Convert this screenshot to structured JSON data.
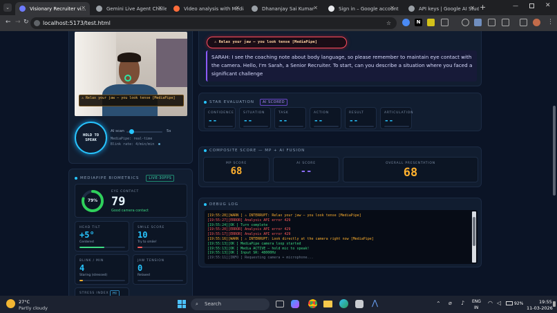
{
  "browser": {
    "tabs": [
      {
        "title": "Visionary Recruiter vi...",
        "active": true,
        "color": "#6e7bff"
      },
      {
        "title": "Gemini Live Agent Challen",
        "active": false,
        "color": "#9aa0a6"
      },
      {
        "title": "Video analysis with Medial",
        "active": false,
        "color": "#ff6d3b"
      },
      {
        "title": "Dhananjay Sai Kumar",
        "active": false,
        "color": "#9aa0a6"
      },
      {
        "title": "Sign in – Google accounts",
        "active": false,
        "color": "#e8eaed"
      },
      {
        "title": "API keys | Google AI Studi",
        "active": false,
        "color": "#9aa0a6"
      }
    ],
    "url": "localhost:5173/test.html"
  },
  "video": {
    "warning": "⚠ Relax your jaw — you look tense [MediaPipe]"
  },
  "controls": {
    "hold_button": "HOLD TO SPEAK",
    "ai_scan_label": "AI scan",
    "ai_scan_value": "5s",
    "mediapipe_status": "MediaPipe: real-time",
    "blink_rate": "Blink rate: 4/min/min"
  },
  "biometrics": {
    "title": "MEDIAPIPE BIOMETRICS",
    "badge": "LIVE·30FPS",
    "eye_contact": {
      "label": "EYE CONTACT",
      "value": "79",
      "ring": "79%",
      "percent": 79,
      "note": "Good camera contact"
    },
    "head_tilt": {
      "label": "HEAD TILT",
      "value": "+5°",
      "note": "Centered",
      "percent": 55
    },
    "smile": {
      "label": "SMILE SCORE",
      "value": "10",
      "note": "Try to smile!",
      "percent": 10
    },
    "blink": {
      "label": "BLINK / MIN",
      "value": "4",
      "note": "Staring (stressed)",
      "percent": 8
    },
    "jaw": {
      "label": "JAW TENSION",
      "value": "0",
      "note": "Relaxed",
      "percent": 0
    },
    "stress": {
      "label": "STRESS INDEX",
      "badge": "HI"
    }
  },
  "chat": {
    "alert": "⚠ Relax your jaw — you look tense [MediaPipe]",
    "message": "SARAH: I see the coaching note about body language, so please remember to maintain eye contact with the camera. Hello, I'm Sarah, a Senior Recruiter. To start, can you describe a situation where you faced a significant challenge"
  },
  "star": {
    "title": "STAR EVALUATION",
    "badge": "AI SCORED",
    "cards": [
      {
        "label": "CONFIDENCE",
        "value": "--"
      },
      {
        "label": "SITUATION",
        "value": "--"
      },
      {
        "label": "TASK",
        "value": "--"
      },
      {
        "label": "ACTION",
        "value": "--"
      },
      {
        "label": "RESULT",
        "value": "--"
      },
      {
        "label": "ARTICULATION",
        "value": "--"
      }
    ]
  },
  "composite": {
    "title": "COMPOSITE SCORE — MP + AI FUSION",
    "mp_label": "MP SCORE",
    "mp_value": "68",
    "ai_label": "AI SCORE",
    "ai_value": "--",
    "overall_label": "OVERALL PRESENTATION",
    "overall_value": "68"
  },
  "debug": {
    "title": "DEBUG LOG",
    "lines": [
      {
        "text": "[19:55:28][WARN ] ⚠ INTERRUPT: Relax your jaw — you look tense [MediaPipe]",
        "color": "#ffb02e"
      },
      {
        "text": "[19:55:27][ERROR] Analysis API error 429",
        "color": "#ff5a5a"
      },
      {
        "text": "[19:55:24][OK   ] Turn complete",
        "color": "#3ddc84"
      },
      {
        "text": "[19:55:20][ERROR] Analysis API error 429",
        "color": "#ff5a5a"
      },
      {
        "text": "[19:55:17][ERROR] Analysis API error 429",
        "color": "#ff5a5a"
      },
      {
        "text": "[19:55:16][WARN ] ⚠ INTERRUPT: Look directly at the camera right now [MediaPipe]",
        "color": "#ffb02e"
      },
      {
        "text": "[19:55:13][OK   ] MediaPipe camera loop started",
        "color": "#3ddc84"
      },
      {
        "text": "[19:55:13][OK   ] Media ACTIVE — hold mic to speak!",
        "color": "#3ddc84"
      },
      {
        "text": "[19:55:13][OK   ] Input SR: 48000Hz",
        "color": "#3ddc84"
      },
      {
        "text": "[19:55:11][INFO ] Requesting camera + microphone...",
        "color": "#6c7a8f"
      }
    ]
  },
  "taskbar": {
    "temp": "27°C",
    "weather": "Partly cloudy",
    "search_placeholder": "Search",
    "lang": "ENG",
    "region": "IN",
    "battery": "92%",
    "time": "19:55",
    "date": "11-03-2026"
  }
}
